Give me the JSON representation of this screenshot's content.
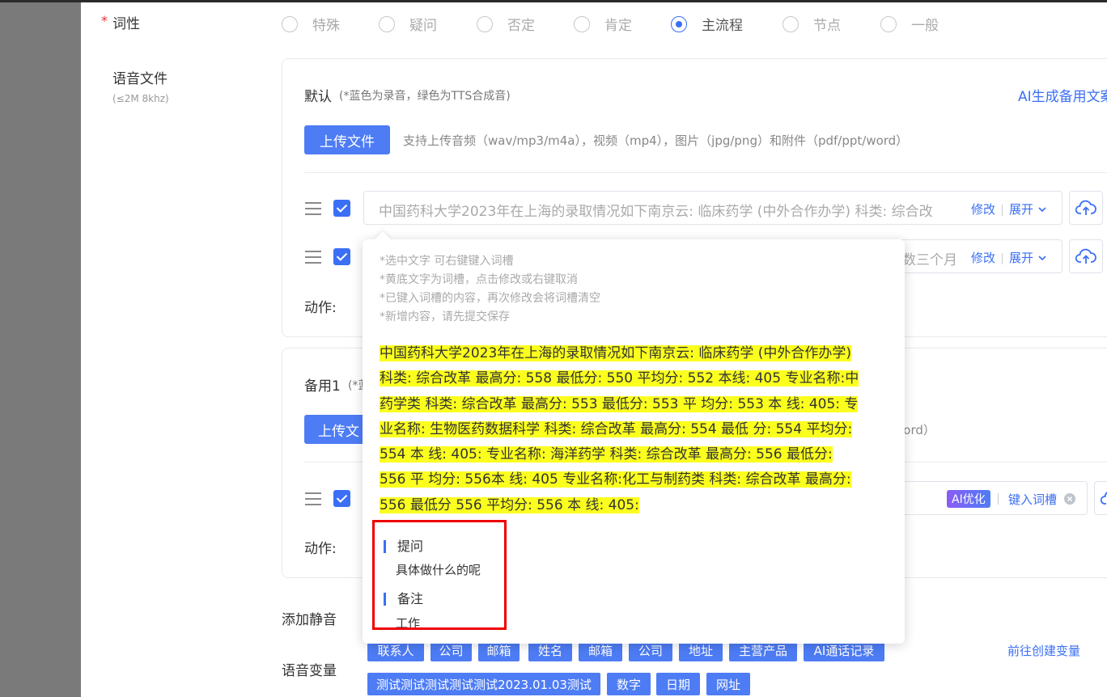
{
  "form": {
    "part_of_speech": {
      "required_mark": "*",
      "label": "词性",
      "options": [
        "特殊",
        "疑问",
        "否定",
        "肯定",
        "主流程",
        "节点",
        "一般"
      ],
      "selected": "主流程"
    },
    "audio_file": {
      "label": "语音文件",
      "sublabel": "(≤2M 8khz)"
    }
  },
  "default_card": {
    "title": "默认",
    "subtitle": "(*蓝色为录音，绿色为TTS合成音)",
    "ai_link": "AI生成备用文案",
    "upload_label": "上传文件",
    "upload_hint": "支持上传音频（wav/mp3/m4a），视频（mp4），图片（jpg/png）和附件（pdf/ppt/word）",
    "row1_text": "中国药科大学2023年在上海的录取情况如下南京云: 临床药学 (中外合作办学) 科类: 综合改",
    "row2_text": "数三个月",
    "edit_label": "修改",
    "expand_label": "展开",
    "action_label": "动作:"
  },
  "backup_card": {
    "title": "备用1",
    "subtitle_fragment": "(*蓝",
    "upload_label": "上传文",
    "upload_hint_tail": "word）",
    "ai_optimize": "AI优化",
    "enter_slot": "键入词槽",
    "action_label": "动作:"
  },
  "popup": {
    "notes": [
      "*选中文字 可右键键入词槽",
      "*黄底文字为词槽，点击修改或右键取消",
      "*已键入词槽的内容，再次修改会将词槽清空",
      "*新增内容，请先提交保存"
    ],
    "highlight_lines": [
      "中国药科大学2023年在上海的录取情况如下南京云: 临床药学 (中外合作办学)",
      "科类: 综合改革 最高分: 558 最低分: 550 平均分: 552 本线: 405 专业名称:中",
      "药学类 科类: 综合改革 最高分: 553 最低分: 553 平 均分: 553 本 线: 405: 专",
      "业名称: 生物医药数据科学 科类: 综合改革 最高分: 554 最低 分: 554 平均分:",
      "554 本 线: 405: 专业名称: 海洋药学 科类: 综合改革 最高分: 556 最低分:",
      "556 平 均分: 556本 线: 405 专业名称:化工与制药类 科类: 综合改革 最高分:",
      "556 最低分 556 平均分: 556 本 线: 405:"
    ],
    "question_title": "提问",
    "question_value": "具体做什么的呢",
    "remark_title": "备注",
    "remark_value": "工作"
  },
  "add_silence": "添加静音",
  "voice_vars": {
    "label": "语音变量",
    "create_link": "前往创建变量",
    "row1": [
      "联系人",
      "公司",
      "邮箱",
      "姓名",
      "邮箱",
      "公司",
      "地址",
      "主营产品",
      "AI通话记录"
    ],
    "row2": [
      "测试测试测试测试测试2023.01.03测试",
      "数字",
      "日期",
      "网址"
    ]
  }
}
